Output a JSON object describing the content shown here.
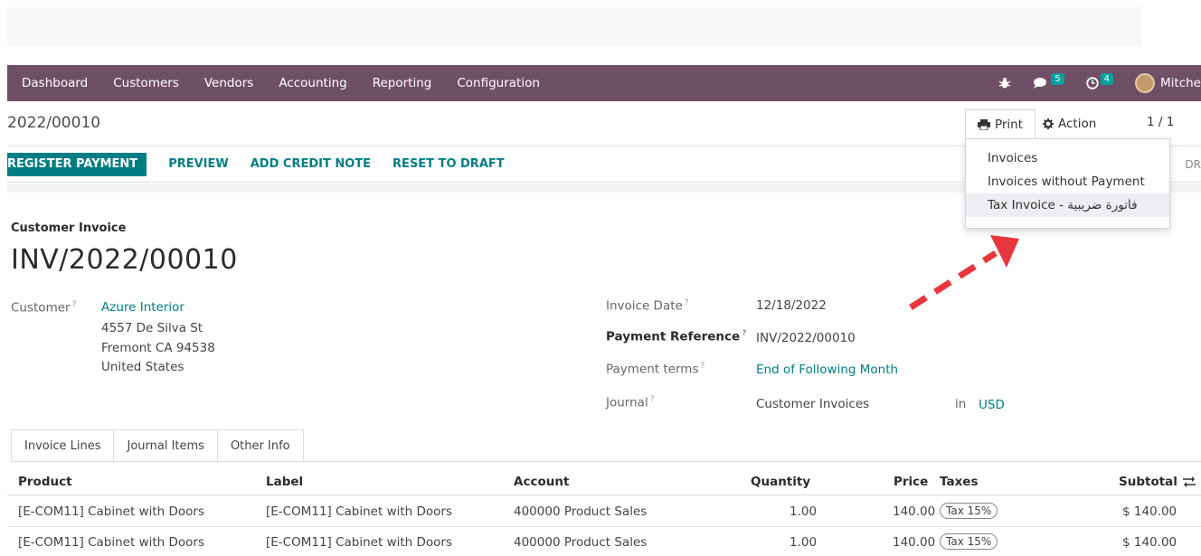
{
  "navbar": {
    "menu": [
      "Dashboard",
      "Customers",
      "Vendors",
      "Accounting",
      "Reporting",
      "Configuration"
    ],
    "messages_count": "5",
    "activities_count": "4",
    "user_name": "Mitche"
  },
  "breadcrumb": "2022/00010",
  "control": {
    "print_label": "Print",
    "action_label": "Action",
    "pager": "1 / 1"
  },
  "print_menu": {
    "items": [
      "Invoices",
      "Invoices without Payment",
      "Tax Invoice - فاتورة ضريبية"
    ]
  },
  "actions": {
    "register_payment": "REGISTER PAYMENT",
    "preview": "PREVIEW",
    "add_credit_note": "ADD CREDIT NOTE",
    "reset_to_draft": "RESET TO DRAFT",
    "status_partial": "DR"
  },
  "invoice": {
    "type_label": "Customer Invoice",
    "number": "INV/2022/00010",
    "customer_label": "Customer",
    "customer_name": "Azure Interior",
    "address_line1": "4557 De Silva St",
    "address_line2": "Fremont CA 94538",
    "address_line3": "United States",
    "invoice_date_label": "Invoice Date",
    "invoice_date": "12/18/2022",
    "payment_reference_label": "Payment Reference",
    "payment_reference": "INV/2022/00010",
    "payment_terms_label": "Payment terms",
    "payment_terms": "End of Following Month",
    "journal_label": "Journal",
    "journal": "Customer Invoices",
    "in_label": "in",
    "currency": "USD"
  },
  "tabs": [
    "Invoice Lines",
    "Journal Items",
    "Other Info"
  ],
  "table": {
    "headers": [
      "Product",
      "Label",
      "Account",
      "Quantity",
      "Price",
      "Taxes",
      "Subtotal"
    ],
    "rows": [
      {
        "product": "[E-COM11] Cabinet with Doors",
        "label": "[E-COM11] Cabinet with Doors",
        "account": "400000 Product Sales",
        "quantity": "1.00",
        "price": "140.00",
        "tax": "Tax 15%",
        "subtotal": "$ 140.00"
      },
      {
        "product": "[E-COM11] Cabinet with Doors",
        "label": "[E-COM11] Cabinet with Doors",
        "account": "400000 Product Sales",
        "quantity": "1.00",
        "price": "140.00",
        "tax": "Tax 15%",
        "subtotal": "$ 140.00"
      }
    ]
  },
  "colors": {
    "navbar": "#6f4f66",
    "primary": "#017e84",
    "arrow": "#e8363d"
  }
}
